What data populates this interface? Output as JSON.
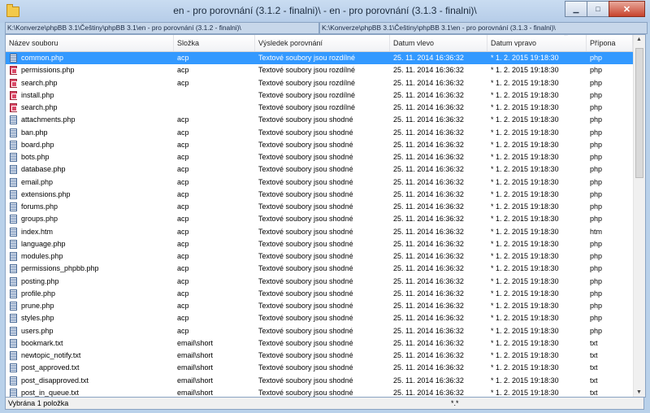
{
  "window": {
    "title": "en - pro porovnání (3.1.2 - finalni)\\ - en - pro porovnání (3.1.3 - finalni)\\",
    "minimize": "▁",
    "maximize": "□",
    "close": "✕"
  },
  "paths": {
    "left": "K:\\Konverze\\phpBB 3.1\\Češtiny\\phpBB 3.1\\en - pro porovnání (3.1.2 - finalni)\\",
    "right": "K:\\Konverze\\phpBB 3.1\\Češtiny\\phpBB 3.1\\en - pro porovnání (3.1.3 - finalni)\\"
  },
  "columns": {
    "name": "Název souboru",
    "folder": "Složka",
    "result": "Výsledek porovnání",
    "left_date": "Datum vlevo",
    "right_date": "Datum vpravo",
    "ext": "Přípona",
    "sort_arrow": "^"
  },
  "rows": [
    {
      "name": "common.php",
      "folder": "acp",
      "result": "Textové soubory jsou rozdílné",
      "left": "25. 11. 2014 16:36:32",
      "right": "* 1. 2. 2015 19:18:30",
      "ext": "php",
      "icon": "text-file-icon"
    },
    {
      "name": "permissions.php",
      "folder": "acp",
      "result": "Textové soubory jsou rozdílné",
      "left": "25. 11. 2014 16:36:32",
      "right": "* 1. 2. 2015 19:18:30",
      "ext": "php",
      "icon": "diff-file-icon"
    },
    {
      "name": "search.php",
      "folder": "acp",
      "result": "Textové soubory jsou rozdílné",
      "left": "25. 11. 2014 16:36:32",
      "right": "* 1. 2. 2015 19:18:30",
      "ext": "php",
      "icon": "diff-file-icon"
    },
    {
      "name": "install.php",
      "folder": "",
      "result": "Textové soubory jsou rozdílné",
      "left": "25. 11. 2014 16:36:32",
      "right": "* 1. 2. 2015 19:18:30",
      "ext": "php",
      "icon": "diff-file-icon"
    },
    {
      "name": "search.php",
      "folder": "",
      "result": "Textové soubory jsou rozdílné",
      "left": "25. 11. 2014 16:36:32",
      "right": "* 1. 2. 2015 19:18:30",
      "ext": "php",
      "icon": "diff-file-icon"
    },
    {
      "name": "attachments.php",
      "folder": "acp",
      "result": "Textové soubory jsou shodné",
      "left": "25. 11. 2014 16:36:32",
      "right": "* 1. 2. 2015 19:18:30",
      "ext": "php",
      "icon": "text-file-icon"
    },
    {
      "name": "ban.php",
      "folder": "acp",
      "result": "Textové soubory jsou shodné",
      "left": "25. 11. 2014 16:36:32",
      "right": "* 1. 2. 2015 19:18:30",
      "ext": "php",
      "icon": "text-file-icon"
    },
    {
      "name": "board.php",
      "folder": "acp",
      "result": "Textové soubory jsou shodné",
      "left": "25. 11. 2014 16:36:32",
      "right": "* 1. 2. 2015 19:18:30",
      "ext": "php",
      "icon": "text-file-icon"
    },
    {
      "name": "bots.php",
      "folder": "acp",
      "result": "Textové soubory jsou shodné",
      "left": "25. 11. 2014 16:36:32",
      "right": "* 1. 2. 2015 19:18:30",
      "ext": "php",
      "icon": "text-file-icon"
    },
    {
      "name": "database.php",
      "folder": "acp",
      "result": "Textové soubory jsou shodné",
      "left": "25. 11. 2014 16:36:32",
      "right": "* 1. 2. 2015 19:18:30",
      "ext": "php",
      "icon": "text-file-icon"
    },
    {
      "name": "email.php",
      "folder": "acp",
      "result": "Textové soubory jsou shodné",
      "left": "25. 11. 2014 16:36:32",
      "right": "* 1. 2. 2015 19:18:30",
      "ext": "php",
      "icon": "text-file-icon"
    },
    {
      "name": "extensions.php",
      "folder": "acp",
      "result": "Textové soubory jsou shodné",
      "left": "25. 11. 2014 16:36:32",
      "right": "* 1. 2. 2015 19:18:30",
      "ext": "php",
      "icon": "text-file-icon"
    },
    {
      "name": "forums.php",
      "folder": "acp",
      "result": "Textové soubory jsou shodné",
      "left": "25. 11. 2014 16:36:32",
      "right": "* 1. 2. 2015 19:18:30",
      "ext": "php",
      "icon": "text-file-icon"
    },
    {
      "name": "groups.php",
      "folder": "acp",
      "result": "Textové soubory jsou shodné",
      "left": "25. 11. 2014 16:36:32",
      "right": "* 1. 2. 2015 19:18:30",
      "ext": "php",
      "icon": "text-file-icon"
    },
    {
      "name": "index.htm",
      "folder": "acp",
      "result": "Textové soubory jsou shodné",
      "left": "25. 11. 2014 16:36:32",
      "right": "* 1. 2. 2015 19:18:30",
      "ext": "htm",
      "icon": "text-file-icon"
    },
    {
      "name": "language.php",
      "folder": "acp",
      "result": "Textové soubory jsou shodné",
      "left": "25. 11. 2014 16:36:32",
      "right": "* 1. 2. 2015 19:18:30",
      "ext": "php",
      "icon": "text-file-icon"
    },
    {
      "name": "modules.php",
      "folder": "acp",
      "result": "Textové soubory jsou shodné",
      "left": "25. 11. 2014 16:36:32",
      "right": "* 1. 2. 2015 19:18:30",
      "ext": "php",
      "icon": "text-file-icon"
    },
    {
      "name": "permissions_phpbb.php",
      "folder": "acp",
      "result": "Textové soubory jsou shodné",
      "left": "25. 11. 2014 16:36:32",
      "right": "* 1. 2. 2015 19:18:30",
      "ext": "php",
      "icon": "text-file-icon"
    },
    {
      "name": "posting.php",
      "folder": "acp",
      "result": "Textové soubory jsou shodné",
      "left": "25. 11. 2014 16:36:32",
      "right": "* 1. 2. 2015 19:18:30",
      "ext": "php",
      "icon": "text-file-icon"
    },
    {
      "name": "profile.php",
      "folder": "acp",
      "result": "Textové soubory jsou shodné",
      "left": "25. 11. 2014 16:36:32",
      "right": "* 1. 2. 2015 19:18:30",
      "ext": "php",
      "icon": "text-file-icon"
    },
    {
      "name": "prune.php",
      "folder": "acp",
      "result": "Textové soubory jsou shodné",
      "left": "25. 11. 2014 16:36:32",
      "right": "* 1. 2. 2015 19:18:30",
      "ext": "php",
      "icon": "text-file-icon"
    },
    {
      "name": "styles.php",
      "folder": "acp",
      "result": "Textové soubory jsou shodné",
      "left": "25. 11. 2014 16:36:32",
      "right": "* 1. 2. 2015 19:18:30",
      "ext": "php",
      "icon": "text-file-icon"
    },
    {
      "name": "users.php",
      "folder": "acp",
      "result": "Textové soubory jsou shodné",
      "left": "25. 11. 2014 16:36:32",
      "right": "* 1. 2. 2015 19:18:30",
      "ext": "php",
      "icon": "text-file-icon"
    },
    {
      "name": "bookmark.txt",
      "folder": "email\\short",
      "result": "Textové soubory jsou shodné",
      "left": "25. 11. 2014 16:36:32",
      "right": "* 1. 2. 2015 19:18:30",
      "ext": "txt",
      "icon": "text-file-icon"
    },
    {
      "name": "newtopic_notify.txt",
      "folder": "email\\short",
      "result": "Textové soubory jsou shodné",
      "left": "25. 11. 2014 16:36:32",
      "right": "* 1. 2. 2015 19:18:30",
      "ext": "txt",
      "icon": "text-file-icon"
    },
    {
      "name": "post_approved.txt",
      "folder": "email\\short",
      "result": "Textové soubory jsou shodné",
      "left": "25. 11. 2014 16:36:32",
      "right": "* 1. 2. 2015 19:18:30",
      "ext": "txt",
      "icon": "text-file-icon"
    },
    {
      "name": "post_disapproved.txt",
      "folder": "email\\short",
      "result": "Textové soubory jsou shodné",
      "left": "25. 11. 2014 16:36:32",
      "right": "* 1. 2. 2015 19:18:30",
      "ext": "txt",
      "icon": "text-file-icon"
    },
    {
      "name": "post_in_queue.txt",
      "folder": "email\\short",
      "result": "Textové soubory jsou shodné",
      "left": "25. 11. 2014 16:36:32",
      "right": "* 1. 2. 2015 19:18:30",
      "ext": "txt",
      "icon": "text-file-icon"
    }
  ],
  "selected_row": 0,
  "scrollbar": {
    "up": "▲",
    "down": "▼"
  },
  "status": {
    "left": "Vybrána 1 položka",
    "mid": "*.*"
  },
  "colors": {
    "selection": "#3399ff",
    "frame": "#b9d1ea"
  }
}
